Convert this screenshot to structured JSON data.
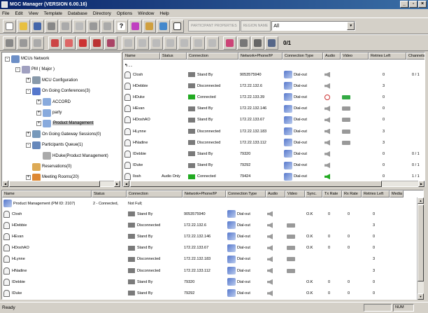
{
  "window": {
    "title": "MGC Manager (VERSION 6.00.16)",
    "controls": [
      "_",
      "▫",
      "×"
    ]
  },
  "menu": [
    "File",
    "Edit",
    "View",
    "Template",
    "Database",
    "Directory",
    "Options",
    "Window",
    "Help"
  ],
  "toolbar": {
    "disabled_box_1": "PARTICIPANT PROPERTIES",
    "disabled_box_2": "REGION NAME",
    "filter_value": "All",
    "fraction": "0/1"
  },
  "tree": [
    {
      "label": "MCUs Network",
      "indent": 0,
      "exp": "-",
      "icon": "#6c8ec6"
    },
    {
      "label": "PM  ( Major )",
      "indent": 1,
      "exp": "-",
      "icon": "#a0a0c0"
    },
    {
      "label": "MCU Configuration",
      "indent": 2,
      "exp": "+",
      "icon": "#8899aa"
    },
    {
      "label": "On Going Conferences(3)",
      "indent": 2,
      "exp": "-",
      "icon": "#5577cc"
    },
    {
      "label": "ACCORD",
      "indent": 3,
      "exp": "+",
      "icon": "#88aadd"
    },
    {
      "label": "party",
      "indent": 3,
      "exp": "+",
      "icon": "#88aadd"
    },
    {
      "label": "Product Management",
      "indent": 3,
      "exp": "+",
      "icon": "#88aadd",
      "selected": true
    },
    {
      "label": "On Going Gateway Sessions(0)",
      "indent": 2,
      "exp": "+",
      "icon": "#7799bb"
    },
    {
      "label": "Participants Queue(1)",
      "indent": 2,
      "exp": "-",
      "icon": "#6688bb"
    },
    {
      "label": "HDuke(Product Management)",
      "indent": 3,
      "exp": "",
      "icon": "#aaaaaa"
    },
    {
      "label": "Reservations(0)",
      "indent": 2,
      "exp": "",
      "icon": "#ddaa55"
    },
    {
      "label": "Meeting Rooms(20)",
      "indent": 2,
      "exp": "+",
      "icon": "#dd8833"
    }
  ],
  "top_grid": {
    "columns": [
      "Name",
      "Status",
      "Connection",
      "Network+Phone/IP",
      "Connection Type",
      "Audio",
      "Video",
      "Retries Left",
      "Channels"
    ],
    "rows": [
      {
        "name": "CIosh",
        "status": "",
        "connection": "Stand By",
        "green": false,
        "network": "9053575940",
        "type": "Dial-out",
        "audio": "spk",
        "video": "",
        "retries": "0",
        "channels": "0 / 1"
      },
      {
        "name": "HDebbie",
        "status": "",
        "connection": "Disconnected",
        "green": false,
        "network": "172.22.132.6",
        "type": "Dial-out",
        "audio": "spk",
        "video": "",
        "retries": "3",
        "channels": ""
      },
      {
        "name": "HDuke",
        "status": "",
        "connection": "Connected",
        "green": true,
        "network": "172.22.133.39",
        "type": "Dial-out",
        "audio": "mute",
        "video": "green",
        "retries": "0",
        "channels": ""
      },
      {
        "name": "HEvan",
        "status": "",
        "connection": "Stand By",
        "green": false,
        "network": "172.22.132.146",
        "type": "Dial-out",
        "audio": "spk",
        "video": "gray",
        "retries": "0",
        "channels": ""
      },
      {
        "name": "HDoshAO",
        "status": "",
        "connection": "Stand By",
        "green": false,
        "network": "172.22.133.67",
        "type": "Dial-out",
        "audio": "spk",
        "video": "gray",
        "retries": "0",
        "channels": ""
      },
      {
        "name": "HLynne",
        "status": "",
        "connection": "Disconnected",
        "green": false,
        "network": "172.22.132.183",
        "type": "Dial-out",
        "audio": "spk",
        "video": "gray",
        "retries": "3",
        "channels": ""
      },
      {
        "name": "HNadine",
        "status": "",
        "connection": "Disconnected",
        "green": false,
        "network": "172.22.133.112",
        "type": "Dial-out",
        "audio": "spk",
        "video": "gray",
        "retries": "3",
        "channels": ""
      },
      {
        "name": "IDebbie",
        "status": "",
        "connection": "Stand By",
        "green": false,
        "network": "79320",
        "type": "Dial-out",
        "audio": "spk",
        "video": "",
        "retries": "0",
        "channels": "0 / 1"
      },
      {
        "name": "IDuke",
        "status": "",
        "connection": "Stand By",
        "green": false,
        "network": "79292",
        "type": "Dial-out",
        "audio": "spk",
        "video": "",
        "retries": "0",
        "channels": "0 / 1"
      },
      {
        "name": "Ilosh",
        "status": "Audio Only",
        "connection": "Connected",
        "green": true,
        "network": "79424",
        "type": "Dial-out",
        "audio": "green",
        "video": "",
        "retries": "0",
        "channels": "1 / 1"
      }
    ]
  },
  "bottom_grid": {
    "columns": [
      "Name",
      "Status",
      "Connection",
      "Network+Phone/IP",
      "Connection Type",
      "Audio",
      "Video",
      "Sync.",
      "Tx Rate",
      "Rx Rate",
      "Retries Left",
      "Media M"
    ],
    "summary": {
      "name": "Product Management (PM ID: 2107)",
      "status": "2 - Connected,",
      "connection": "Not Full;"
    },
    "rows": [
      {
        "name": "CIosh",
        "connection": "Stand By",
        "network": "9053575940",
        "type": "Dial-out",
        "video": "",
        "sync": "O.K",
        "tx": "0",
        "rx": "0",
        "retries": "0"
      },
      {
        "name": "HDebbie",
        "connection": "Disconnected",
        "network": "172.22.132.6",
        "type": "Dial-out",
        "video": "gray",
        "sync": "",
        "tx": "",
        "rx": "",
        "retries": "3"
      },
      {
        "name": "HEvan",
        "connection": "Stand By",
        "network": "172.22.132.146",
        "type": "Dial-out",
        "video": "gray",
        "sync": "O.K",
        "tx": "0",
        "rx": "0",
        "retries": "0"
      },
      {
        "name": "HDoshAO",
        "connection": "Stand By",
        "network": "172.22.133.67",
        "type": "Dial-out",
        "video": "gray",
        "sync": "O.K",
        "tx": "0",
        "rx": "0",
        "retries": "0"
      },
      {
        "name": "HLynne",
        "connection": "Disconnected",
        "network": "172.22.132.183",
        "type": "Dial-out",
        "video": "gray",
        "sync": "",
        "tx": "",
        "rx": "",
        "retries": "3"
      },
      {
        "name": "HNadine",
        "connection": "Disconnected",
        "network": "172.22.133.112",
        "type": "Dial-out",
        "video": "gray",
        "sync": "",
        "tx": "",
        "rx": "",
        "retries": "3"
      },
      {
        "name": "IDebbie",
        "connection": "Stand By",
        "network": "79320",
        "type": "Dial-out",
        "video": "",
        "sync": "O.K",
        "tx": "0",
        "rx": "0",
        "retries": "0"
      },
      {
        "name": "IDuke",
        "connection": "Stand By",
        "network": "79292",
        "type": "Dial-out",
        "video": "",
        "sync": "O.K",
        "tx": "0",
        "rx": "0",
        "retries": "0"
      }
    ]
  },
  "status": {
    "text": "Ready",
    "num": "NUM"
  }
}
